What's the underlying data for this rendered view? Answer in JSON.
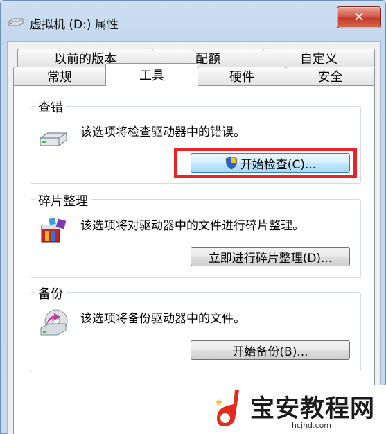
{
  "window": {
    "title": "虚拟机 (D:) 属性",
    "close_label": "✕"
  },
  "tabs": {
    "row1": [
      "以前的版本",
      "配额",
      "自定义"
    ],
    "row2": [
      "常规",
      "工具",
      "硬件",
      "安全"
    ],
    "active": "工具"
  },
  "groups": {
    "error_check": {
      "title": "查错",
      "description": "该选项将检查驱动器中的错误。",
      "button_label": "开始检查(C)...",
      "icon": "drive-icon"
    },
    "defrag": {
      "title": "碎片整理",
      "description": "该选项将对驱动器中的文件进行碎片整理。",
      "button_label": "立即进行碎片整理(D)...",
      "icon": "defrag-icon"
    },
    "backup": {
      "title": "备份",
      "description": "该选项将备份驱动器中的文件。",
      "button_label": "开始备份(B)...",
      "icon": "backup-icon"
    }
  },
  "watermark": {
    "text": "宝安教程网",
    "url": "hcjhd.com"
  },
  "colors": {
    "highlight": "#e8242a",
    "close_button": "#c13b2a"
  }
}
